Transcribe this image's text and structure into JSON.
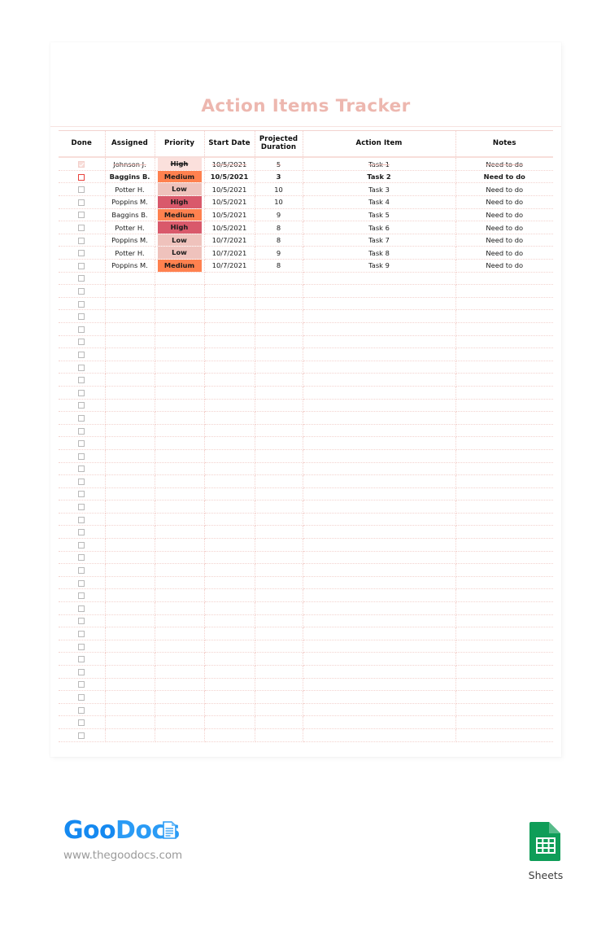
{
  "document": {
    "title": "Action Items Tracker"
  },
  "table": {
    "columns": [
      {
        "key": "done",
        "label": "Done"
      },
      {
        "key": "assigned",
        "label": "Assigned"
      },
      {
        "key": "priority",
        "label": "Priority"
      },
      {
        "key": "start",
        "label": "Start Date"
      },
      {
        "key": "duration",
        "label": "Projected\nDuration"
      },
      {
        "key": "action",
        "label": "Action Item"
      },
      {
        "key": "notes",
        "label": "Notes"
      }
    ],
    "column_labels": {
      "done": "Done",
      "assigned": "Assigned",
      "priority": "Priority",
      "start_date": "Start Date",
      "projected_duration_line1": "Projected",
      "projected_duration_line2": "Duration",
      "action_item": "Action Item",
      "notes": "Notes"
    },
    "priority_colors": {
      "High": "#D9596B",
      "Medium": "#FF814F",
      "Low": "#EFC2BC",
      "High_done": "#FBE0DC",
      "Medium_done": "#FBE0DC"
    },
    "accent_colors": {
      "title": "#EDB7AF",
      "active_row_text": "#E8413C",
      "done_row_text": "#F4C9C4",
      "grid_line": "#F3D2CE",
      "header_rule": "#F7DEDA"
    },
    "rows": [
      {
        "done": true,
        "state": "done",
        "assigned": "Johnson J.",
        "priority": "High",
        "start": "10/5/2021",
        "duration": "5",
        "action": "Task 1",
        "notes": "Need to do"
      },
      {
        "done": false,
        "state": "active",
        "assigned": "Baggins B.",
        "priority": "Medium",
        "start": "10/5/2021",
        "duration": "3",
        "action": "Task 2",
        "notes": "Need to do"
      },
      {
        "done": false,
        "state": "normal",
        "assigned": "Potter H.",
        "priority": "Low",
        "start": "10/5/2021",
        "duration": "10",
        "action": "Task 3",
        "notes": "Need to do"
      },
      {
        "done": false,
        "state": "normal",
        "assigned": "Poppins M.",
        "priority": "High",
        "start": "10/5/2021",
        "duration": "10",
        "action": "Task 4",
        "notes": "Need to do"
      },
      {
        "done": false,
        "state": "normal",
        "assigned": "Baggins B.",
        "priority": "Medium",
        "start": "10/5/2021",
        "duration": "9",
        "action": "Task 5",
        "notes": "Need to do"
      },
      {
        "done": false,
        "state": "normal",
        "assigned": "Potter H.",
        "priority": "High",
        "start": "10/5/2021",
        "duration": "8",
        "action": "Task 6",
        "notes": "Need to do"
      },
      {
        "done": false,
        "state": "normal",
        "assigned": "Poppins M.",
        "priority": "Low",
        "start": "10/7/2021",
        "duration": "8",
        "action": "Task 7",
        "notes": "Need to do"
      },
      {
        "done": false,
        "state": "normal",
        "assigned": "Potter H.",
        "priority": "Low",
        "start": "10/7/2021",
        "duration": "9",
        "action": "Task 8",
        "notes": "Need to do"
      },
      {
        "done": false,
        "state": "normal",
        "assigned": "Poppins M.",
        "priority": "Medium",
        "start": "10/7/2021",
        "duration": "8",
        "action": "Task 9",
        "notes": "Need to do"
      }
    ],
    "empty_row_count": 37
  },
  "footer": {
    "logo_part1": "Goo",
    "logo_part2": "Docs",
    "url": "www.thegoodocs.com",
    "sheets_label": "Sheets",
    "sheets_color": "#0F9D58"
  }
}
